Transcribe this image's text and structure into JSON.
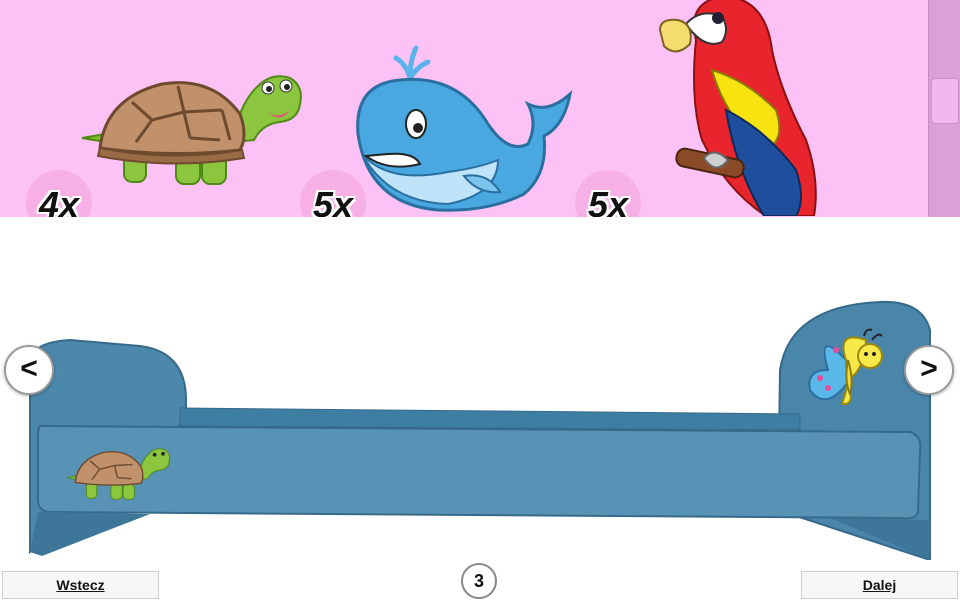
{
  "strip": {
    "background": "#fdc2f5",
    "items": [
      {
        "animal": "turtle-icon",
        "count": "4x"
      },
      {
        "animal": "whale-icon",
        "count": "5x"
      },
      {
        "animal": "parrot-icon",
        "count": "5x"
      }
    ]
  },
  "bed": {
    "color": "#4b88ac",
    "decorations": [
      "turtle-icon",
      "butterfly-icon"
    ]
  },
  "nav": {
    "prev_arrow": "<",
    "next_arrow": ">",
    "page": "3",
    "back_label": "Wstecz",
    "next_label": "Dalej"
  }
}
